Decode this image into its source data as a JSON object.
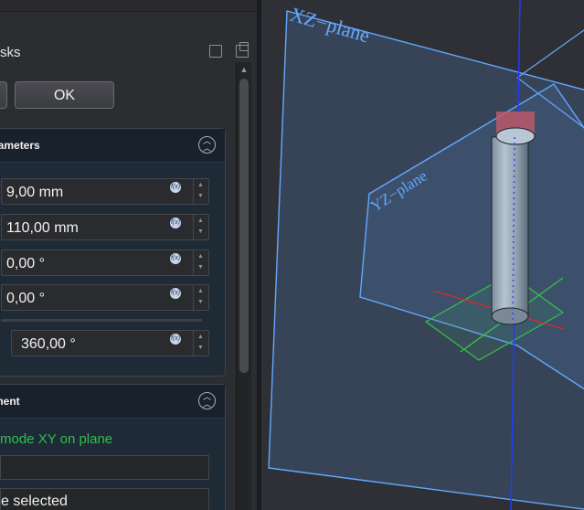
{
  "panel": {
    "tab_title": "sks",
    "buttons": {
      "cancel_label": "",
      "ok_label": "OK"
    },
    "params_title": "rameters",
    "fields": [
      {
        "value": "9,00 mm"
      },
      {
        "value": "110,00 mm"
      },
      {
        "value": "0,00 °"
      },
      {
        "value": "0,00 °"
      },
      {
        "value": "360,00 °"
      }
    ],
    "fx_label": "f(x)",
    "attachment_title": "ment",
    "attachment_mode": "mode XY on plane",
    "reference_selected": "e selected"
  },
  "view3d": {
    "xz_label": "XZ−plane",
    "yz_label": "YZ−plane"
  },
  "colors": {
    "plane": "#62a8ff",
    "axis_blue": "#1f3cff",
    "axis_red": "#d82a2a",
    "axis_green": "#35c24a",
    "selected_green": "#2fbf4a"
  }
}
